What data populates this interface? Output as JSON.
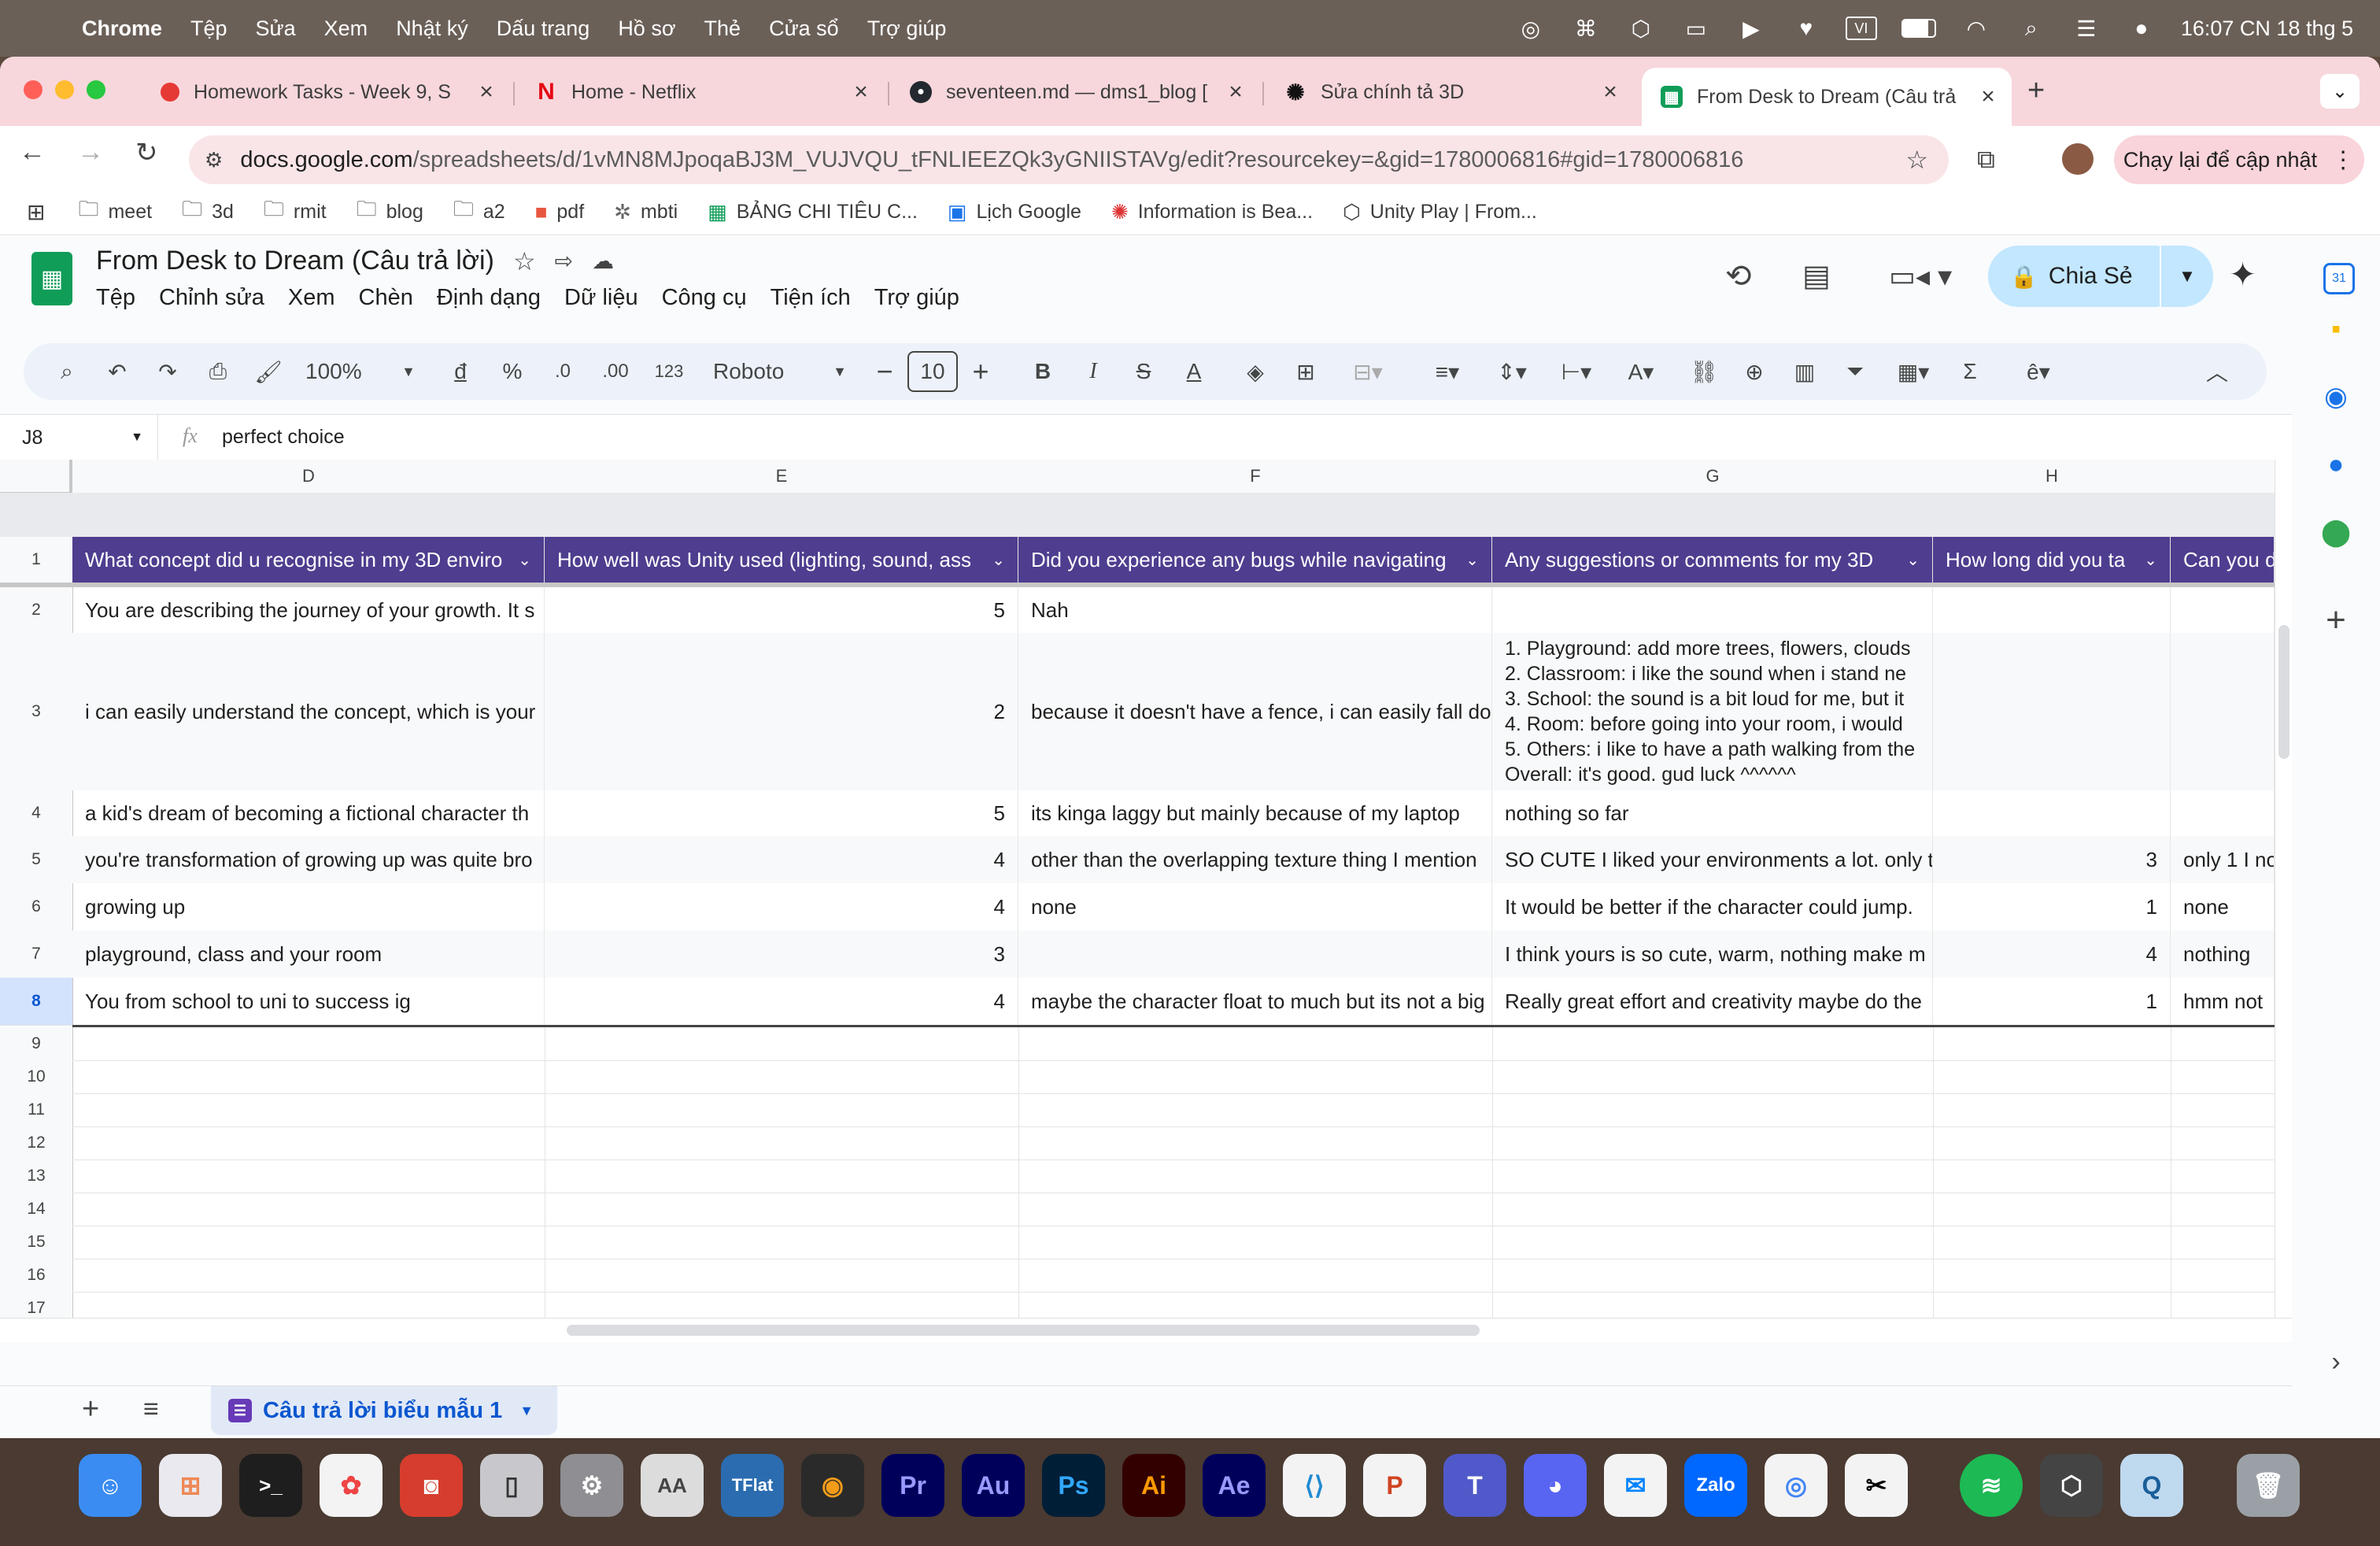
{
  "menubar": {
    "app": "Chrome",
    "items": [
      "Tệp",
      "Sửa",
      "Xem",
      "Nhật ký",
      "Dấu trang",
      "Hồ sơ",
      "Thẻ",
      "Cửa sổ",
      "Trợ giúp"
    ],
    "clock": "16:07 CN 18 thg 5"
  },
  "tabs": [
    {
      "title": "Homework Tasks - Week 9, S",
      "color": "#e53935"
    },
    {
      "title": "Home - Netflix",
      "color": "#e50914"
    },
    {
      "title": "seventeen.md — dms1_blog [",
      "color": "#24292f"
    },
    {
      "title": "Sửa chính tả 3D",
      "color": "#111111"
    },
    {
      "title": "From Desk to Dream (Câu trả",
      "color": "#0f9d58"
    }
  ],
  "address": {
    "url_host": "docs.google.com",
    "url_path": "/spreadsheets/d/1vMN8MJpoqaBJ3M_VUJVQU_tFNLIEEZQk3yGNIISTAVg/edit?resourcekey=&gid=1780006816#gid=1780006816",
    "relaunch": "Chạy lại để cập nhật"
  },
  "bookmarks": [
    "meet",
    "3d",
    "rmit",
    "blog",
    "a2",
    "pdf",
    "mbti",
    "BẢNG CHI TIÊU C...",
    "Lịch Google",
    "Information is Bea...",
    "Unity Play | From..."
  ],
  "doc": {
    "title": "From Desk to Dream (Câu trả lời)",
    "menus": [
      "Tệp",
      "Chỉnh sửa",
      "Xem",
      "Chèn",
      "Định dạng",
      "Dữ liệu",
      "Công cụ",
      "Tiện ích",
      "Trợ giúp"
    ],
    "share": "Chia Sẻ"
  },
  "toolbar": {
    "zoom": "100%",
    "currency": "đ",
    "percent": "%",
    "dec_down": ".0",
    "dec_up": ".00",
    "format_num": "123",
    "font": "Roboto",
    "font_size": "10"
  },
  "formula_bar": {
    "cell_ref": "J8",
    "fx": "fx",
    "value": "perfect choice"
  },
  "columns": [
    "D",
    "E",
    "F",
    "G",
    "H"
  ],
  "header_row": {
    "D": "What concept did u recognise in my 3D enviro",
    "E": "How well was Unity used (lighting, sound, ass",
    "F": "Did you experience any bugs while navigating",
    "G": "Any suggestions or comments for my 3D",
    "H": "How long did you ta",
    "I": "Can you d"
  },
  "rows": [
    {
      "n": "2",
      "D": "You are describing the journey of your growth. It s",
      "E": "5",
      "F": "Nah",
      "G": "",
      "H": "",
      "I": ""
    },
    {
      "n": "3",
      "D": "i can easily understand the concept, which is your",
      "E": "2",
      "F": "because it doesn't have a fence, i can easily fall do",
      "G_lines": [
        "1. Playground: add more trees, flowers, clouds",
        "2. Classroom: i like the sound when i stand ne",
        "3. School: the sound is a bit loud for me, but it",
        "4. Room: before going into your room, i would",
        "5. Others: i like to have a path walking from the",
        "Overall: it's good. gud luck ^^^^^^"
      ],
      "H": "",
      "I": ""
    },
    {
      "n": "4",
      "D": "a kid's dream of becoming a fictional character th",
      "E": "5",
      "F": "its kinga laggy but mainly because of my laptop",
      "G": "nothing so far",
      "H": "",
      "I": ""
    },
    {
      "n": "5",
      "D": "you're transformation of growing up was quite bro",
      "E": "4",
      "F": "other than the overlapping texture thing I mention",
      "G": "SO CUTE I liked your environments a lot. only t",
      "H": "3",
      "I": "only 1 I no"
    },
    {
      "n": "6",
      "D": "growing up",
      "E": "4",
      "F": "none",
      "G": "It would be better if the character could jump.",
      "H": "1",
      "I": "none"
    },
    {
      "n": "7",
      "D": "playground, class and your room",
      "E": "3",
      "F": "",
      "G": "I think yours is so cute, warm, nothing make m",
      "H": "4",
      "I": "nothing"
    },
    {
      "n": "8",
      "D": "You from school to uni to success ig",
      "E": "4",
      "F": "maybe the character float to much but its not a big",
      "G": "Really great effort and creativity maybe do the",
      "H": "1",
      "I": "hmm not"
    }
  ],
  "empty_rows": [
    "9",
    "10",
    "11",
    "12",
    "13",
    "14",
    "15",
    "16",
    "17"
  ],
  "sheet_tab": "Câu trả lời biểu mẫu 1",
  "dock_apps": [
    "Pr",
    "Au",
    "Ps",
    "Ai",
    "Ae",
    "Zalo",
    "TFlat"
  ]
}
